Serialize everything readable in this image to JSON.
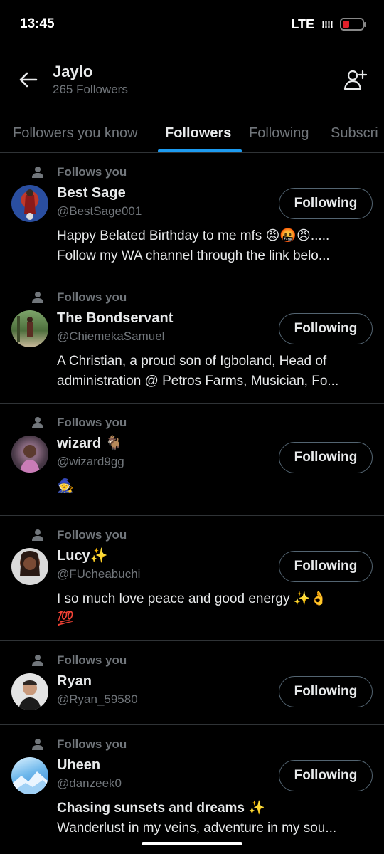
{
  "status": {
    "time": "13:45",
    "network": "LTE",
    "signal": "!!!!"
  },
  "header": {
    "name": "Jaylo",
    "followers": "265 Followers"
  },
  "tabs": [
    {
      "label": "Followers you know"
    },
    {
      "label": "Followers"
    },
    {
      "label": "Following"
    },
    {
      "label": "Subscri"
    }
  ],
  "follows_you": "Follows you",
  "button_label": "Following",
  "users": [
    {
      "name": "Best Sage",
      "handle": "@BestSage001",
      "bio": [
        "Happy Belated Birthday to me mfs 😡🤬😠.....",
        "Follow my WA channel through the link belo..."
      ]
    },
    {
      "name": "The Bondservant",
      "handle": "@ChiemekaSamuel",
      "bio": [
        "A Christian, a proud son of Igboland, Head of",
        "administration @ Petros Farms, Musician, Fo..."
      ]
    },
    {
      "name": "wizard 🐐",
      "handle": "@wizard9gg",
      "bio": [
        "🧙"
      ]
    },
    {
      "name": "Lucy✨",
      "handle": "@FUcheabuchi",
      "bio": [
        "I so much love peace and good energy ✨👌",
        "💯"
      ]
    },
    {
      "name": "Ryan",
      "handle": "@Ryan_59580",
      "bio": []
    },
    {
      "name": "Uheen",
      "handle": "@danzeek0",
      "bio_bold": "Chasing sunsets and dreams ✨",
      "bio": [
        "Wanderlust in my veins, adventure in my sou..."
      ]
    }
  ],
  "colors": {
    "accent": "#1d9bf0",
    "muted": "#71767b",
    "border": "#2f3336"
  }
}
